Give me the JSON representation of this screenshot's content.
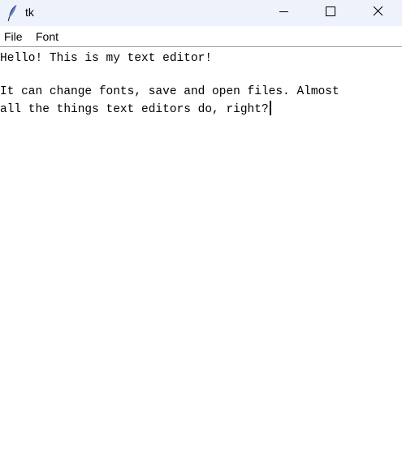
{
  "window": {
    "title": "tk",
    "icon": "feather-icon",
    "controls": {
      "minimize": "minimize-icon",
      "maximize": "maximize-icon",
      "close": "close-icon"
    }
  },
  "menubar": {
    "items": [
      {
        "label": "File"
      },
      {
        "label": "Font"
      }
    ]
  },
  "editor": {
    "lines": [
      "Hello! This is my text editor!",
      "",
      "It can change fonts, save and open files. Almost",
      "all the things text editors do, right?"
    ]
  },
  "colors": {
    "titlebar_bg": "#eef2fb",
    "editor_bg": "#ffffff",
    "text": "#000000"
  }
}
